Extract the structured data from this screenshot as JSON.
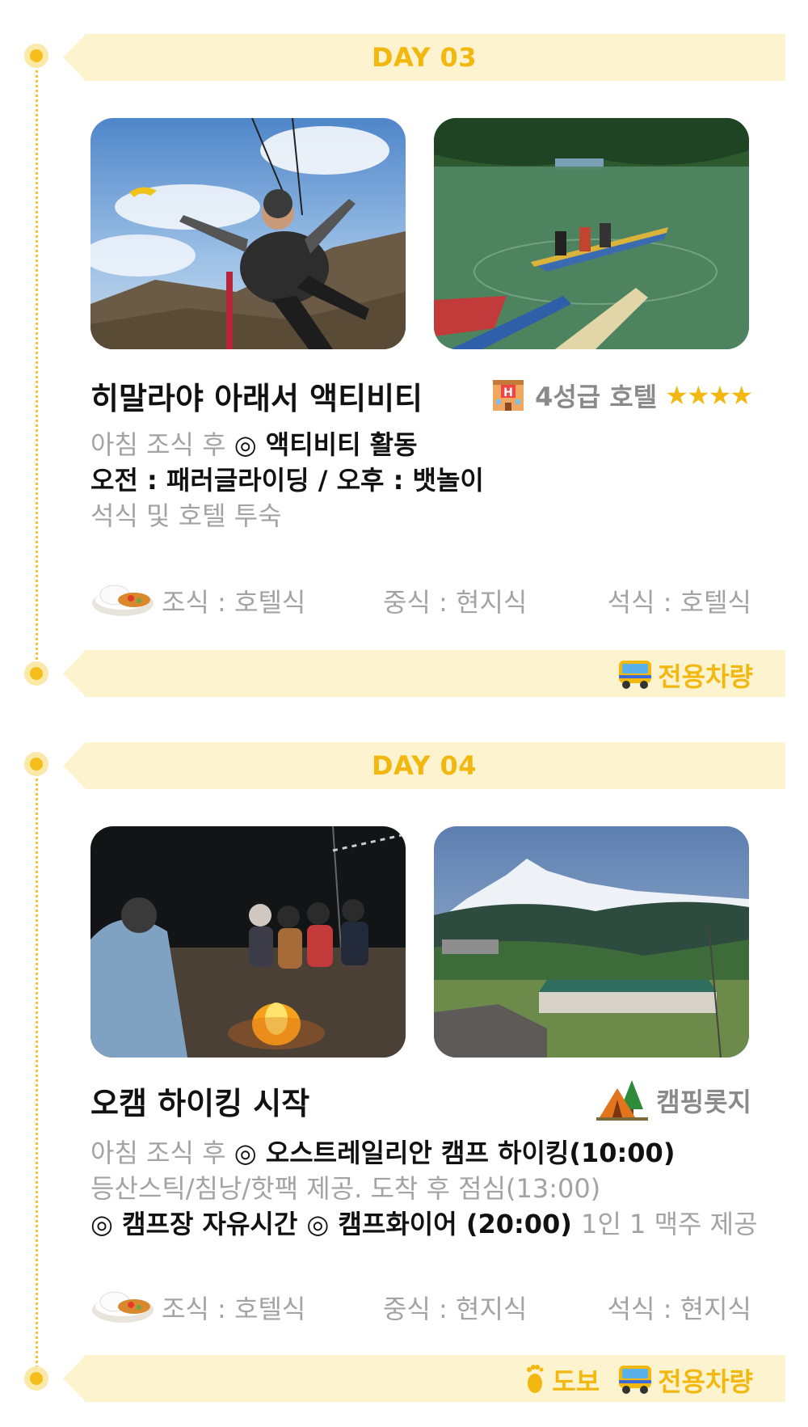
{
  "days": [
    {
      "day_label": "DAY 03",
      "title": "히말라야 아래서 액티비티",
      "stay": {
        "icon": "hotel-icon",
        "label": "4성급 호텔",
        "stars": "★★★★",
        "star_count": 4
      },
      "lines": [
        {
          "gray": "아침 조식 후 ",
          "dark": "◎ 액티비티 활동"
        },
        {
          "dark": "오전 : 패러글라이딩 / 오후 : 뱃놀이"
        },
        {
          "gray": "석식 및 호텔 투숙"
        }
      ],
      "meals": {
        "breakfast": "조식 : 호텔식",
        "lunch": "중식 : 현지식",
        "dinner": "석식 : 호텔식"
      },
      "transport": [
        {
          "icon": "bus-icon",
          "label": "전용차량"
        }
      ],
      "photos": [
        "paragliding-photo",
        "boat-lake-photo"
      ]
    },
    {
      "day_label": "DAY 04",
      "title": "오캠 하이킹 시작",
      "stay": {
        "icon": "camping-tent-icon",
        "label": "캠핑롯지"
      },
      "lines": [
        {
          "gray": "아침 조식 후 ",
          "dark": "◎ 오스트레일리안 캠프 하이킹(10:00)"
        },
        {
          "gray": "등산스틱/침낭/핫팩 제공. 도착 후 점심(13:00)"
        },
        {
          "dark": "◎ 캠프장 자유시간 ◎ 캠프화이어 (20:00) ",
          "gray2": "1인 1 맥주 제공"
        }
      ],
      "meals": {
        "breakfast": "조식 : 호텔식",
        "lunch": "중식 : 현지식",
        "dinner": "석식 : 현지식"
      },
      "transport": [
        {
          "icon": "footprint-icon",
          "label": "도보"
        },
        {
          "icon": "bus-icon",
          "label": "전용차량"
        }
      ],
      "photos": [
        "campfire-photo",
        "mountain-lodge-photo"
      ]
    }
  ],
  "colors": {
    "accent": "#f2b80f",
    "banner_bg": "#fdf4cf",
    "gray_text": "#a3a3a3",
    "dark_text": "#111111"
  }
}
